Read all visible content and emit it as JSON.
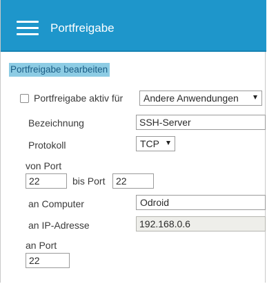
{
  "header": {
    "title": "Portfreigabe",
    "menu_icon": "hamburger-menu-icon"
  },
  "section": {
    "title": "Portfreigabe bearbeiten"
  },
  "form": {
    "enable": {
      "label": "Portfreigabe aktiv für",
      "checked": false,
      "selected": "Andere Anwendungen"
    },
    "bezeichnung": {
      "label": "Bezeichnung",
      "value": "SSH-Server"
    },
    "protokoll": {
      "label": "Protokoll",
      "selected": "TCP"
    },
    "von_port": {
      "label": "von Port",
      "value": "22"
    },
    "bis_port": {
      "label": "bis Port",
      "value": "22"
    },
    "an_computer": {
      "label": "an Computer",
      "selected": "Odroid"
    },
    "ip_adresse": {
      "label": "an IP-Adresse",
      "value": "192.168.0.6"
    },
    "an_port": {
      "label": "an Port",
      "value": "22"
    }
  },
  "colors": {
    "header_bg": "#1e96cb",
    "section_highlight": "#8dcce4",
    "readonly_bg": "#eeeeea"
  }
}
